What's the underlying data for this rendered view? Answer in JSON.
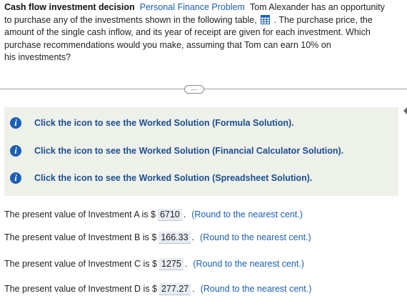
{
  "problem": {
    "title": "Cash flow investment decision",
    "topic": "Personal Finance Problem",
    "line1_text": "Tom Alexander has an opportunity",
    "line2_text": "to purchase any of the investments shown in the following table,",
    "line2_tail": ". The purchase price, the",
    "line3": "amount of the single cash inflow, and its year of receipt are given for each investment. Which",
    "line4": "purchase recommendations would you make, assuming that Tom can earn 10% on",
    "line5": "his investments?",
    "table_icon": "table-grid-icon"
  },
  "expand_button": "…",
  "worked_solutions": [
    {
      "label": "Click the icon to see the Worked Solution (Formula Solution).",
      "icon": "info-icon"
    },
    {
      "label": "Click the icon to see the Worked Solution (Financial Calculator Solution).",
      "icon": "info-icon"
    },
    {
      "label": "Click the icon to see the Worked Solution (Spreadsheet Solution).",
      "icon": "info-icon"
    }
  ],
  "answers": [
    {
      "prefix": "The present value of Investment A is $",
      "value": "6710",
      "tail": ".",
      "hint": "(Round to the nearest cent.)"
    },
    {
      "prefix": "The present value of Investment B is $",
      "value": "166.33",
      "tail": ".",
      "hint": "(Round to the nearest cent.)"
    },
    {
      "prefix": "The present value of Investment C is $",
      "value": "1275",
      "tail": ".",
      "hint": "(Round to the nearest cent.)"
    },
    {
      "prefix": "The present value of Investment D is $",
      "value": "277.27",
      "tail": ".",
      "hint": "(Round to the nearest cent.)"
    }
  ],
  "colors": {
    "link": "#1a5fb4",
    "info_bg": "#eef0ea",
    "answer_box": "#e6ecf2"
  }
}
